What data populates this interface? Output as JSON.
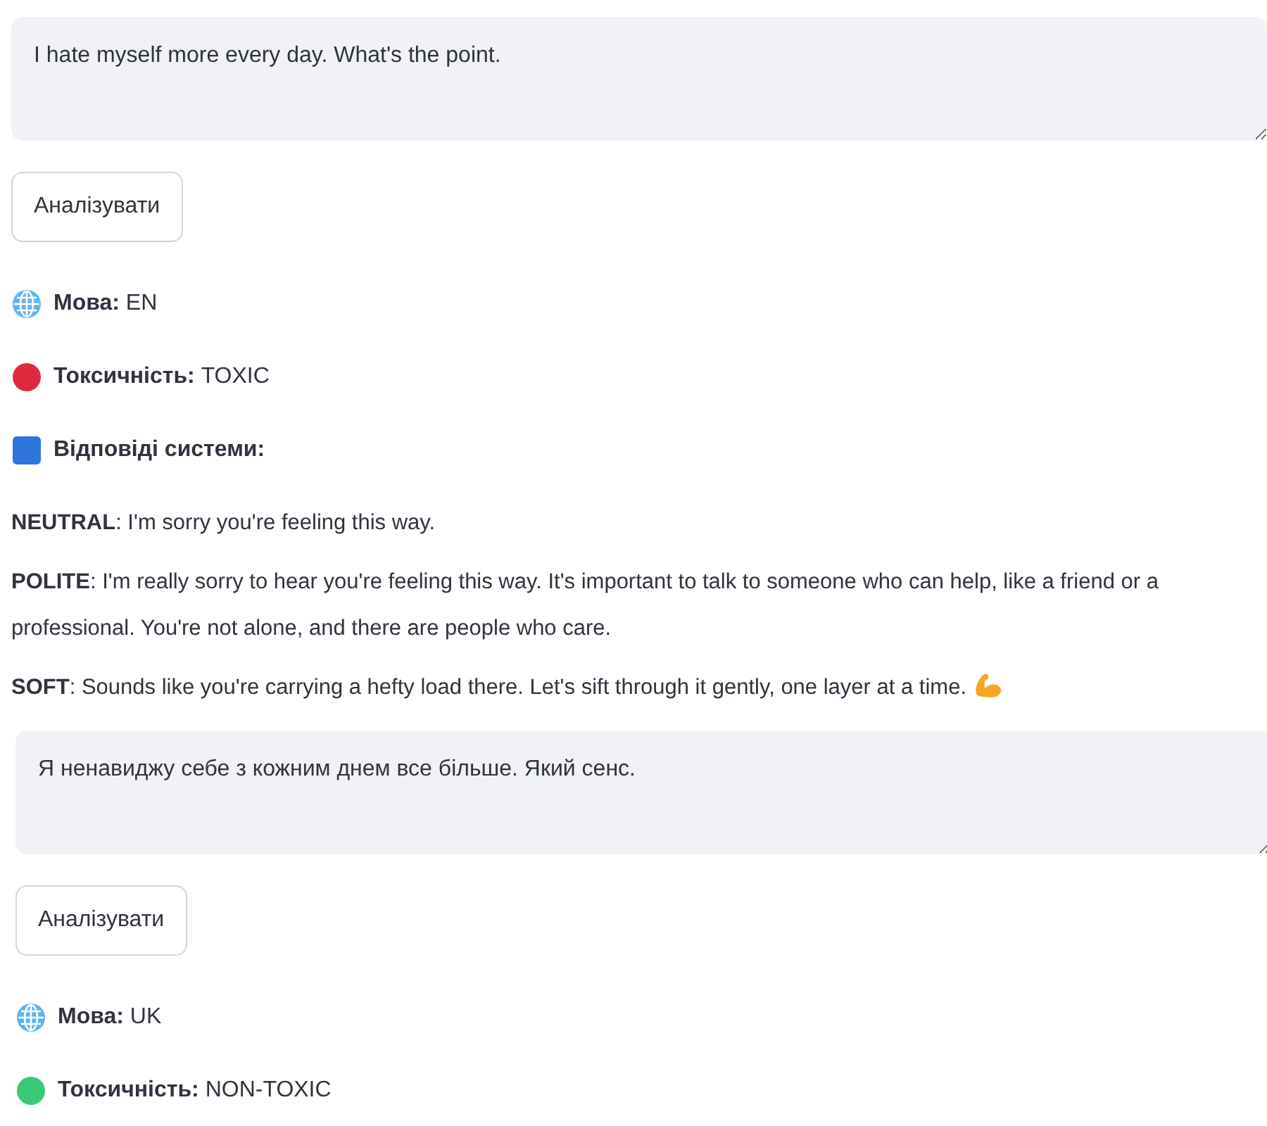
{
  "blocks": [
    {
      "input": {
        "value": "I hate myself more every day. What's the point."
      },
      "button": "Аналізувати",
      "language": {
        "label": "Мова:",
        "value": "EN"
      },
      "toxicity": {
        "label": "Токсичність:",
        "value": "TOXIC",
        "color": "#e0283c"
      },
      "responses_heading": "Відповіді системи:",
      "responses": [
        {
          "text": "**NEUTRAL**: I'm sorry you're feeling this way.",
          "kind": "plain"
        },
        {
          "text": "**POLITE**: I'm really sorry to hear you're feeling this way. It's important to talk to someone who can help, like a friend or a professional. You're not alone, and there are people who care.",
          "kind": "plain"
        },
        {
          "text": "**SOFT**: Sounds like you're carrying a hefty load there. Let's sift through it gently, one layer at a time.",
          "kind": "flex"
        }
      ]
    },
    {
      "input": {
        "value": "Я ненавиджу себе з кожним днем все більше. Який сенс."
      },
      "button": "Аналізувати",
      "language": {
        "label": "Мова:",
        "value": "UK"
      },
      "toxicity": {
        "label": "Токсичність:",
        "value": "NON-TOXIC",
        "color": "#3cc878"
      }
    }
  ]
}
